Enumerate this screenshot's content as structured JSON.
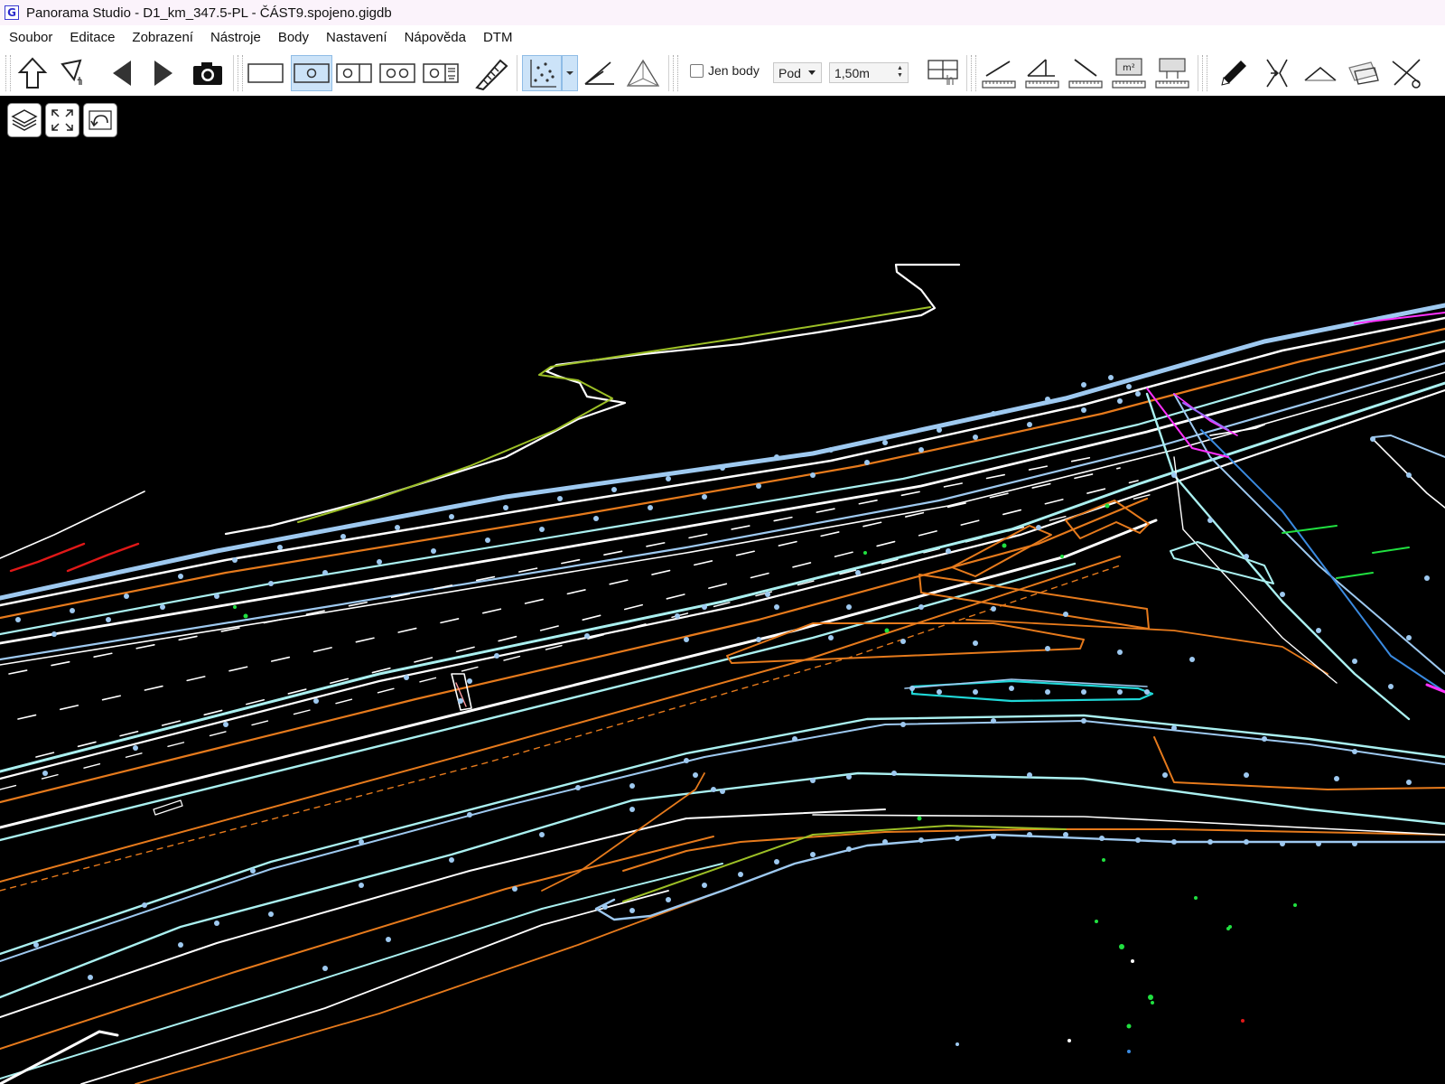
{
  "window": {
    "title": "Panorama Studio - D1_km_347.5-PL - ČÁST9.spojeno.gigdb",
    "app_icon_letter": "G"
  },
  "menu": [
    "Soubor",
    "Editace",
    "Zobrazení",
    "Nástroje",
    "Body",
    "Nastavení",
    "Nápověda",
    "DTM"
  ],
  "toolbar": {
    "jen_body_label": "Jen body",
    "jen_body_checked": false,
    "position_select": "Pod",
    "height_value": "1,50m",
    "active_tools": [
      "circle-frame-tool",
      "point-cloud-tool"
    ]
  },
  "viewport": {
    "background": "#000000",
    "colors": {
      "white": "#ffffff",
      "light_blue": "#9ec9f0",
      "cyan": "#aaf0f0",
      "orange": "#e67a1c",
      "olive": "#9cbf26",
      "red": "#e01818",
      "magenta": "#ff30ff",
      "blue": "#3a8ae0",
      "green": "#20e040"
    }
  }
}
